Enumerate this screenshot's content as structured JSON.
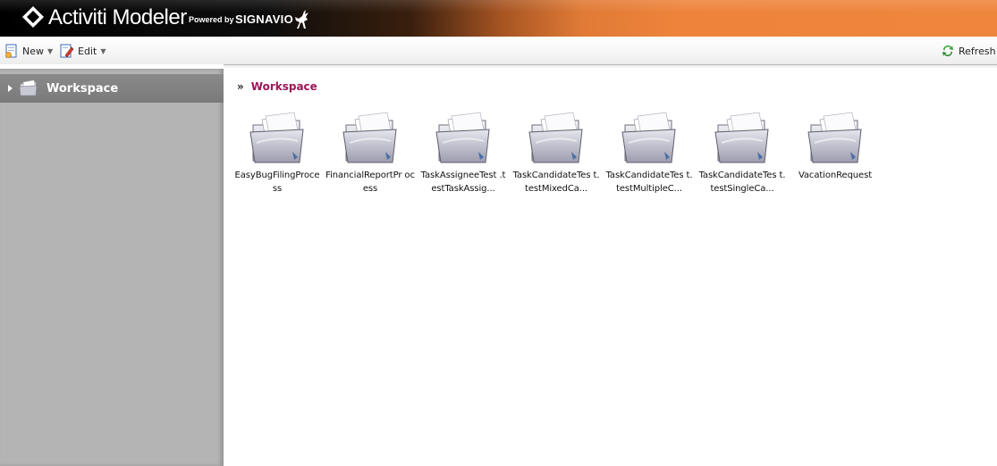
{
  "header": {
    "app_name": "Activiti Modeler",
    "powered_by": "Powered by",
    "brand": "SIGNAVIO"
  },
  "toolbar": {
    "new_label": "New",
    "edit_label": "Edit",
    "refresh_label": "Refresh"
  },
  "sidebar": {
    "items": [
      {
        "label": "Workspace",
        "icon": "folder-icon",
        "expanded": false
      }
    ]
  },
  "breadcrumb": {
    "separator": "»",
    "current": "Workspace"
  },
  "folders": [
    {
      "name": "EasyBugFilingProce ss"
    },
    {
      "name": "FinancialReportPr ocess"
    },
    {
      "name": "TaskAssigneeTest .testTaskAssig..."
    },
    {
      "name": "TaskCandidateTes t.testMixedCa..."
    },
    {
      "name": "TaskCandidateTes t.testMultipleC..."
    },
    {
      "name": "TaskCandidateTes t.testSingleCa..."
    },
    {
      "name": "VacationRequest"
    }
  ],
  "colors": {
    "header_orange": "#ef863d",
    "breadcrumb_accent": "#9c1657",
    "sidebar_bg": "#b4b4b4",
    "sidebar_selected": "#808080"
  }
}
